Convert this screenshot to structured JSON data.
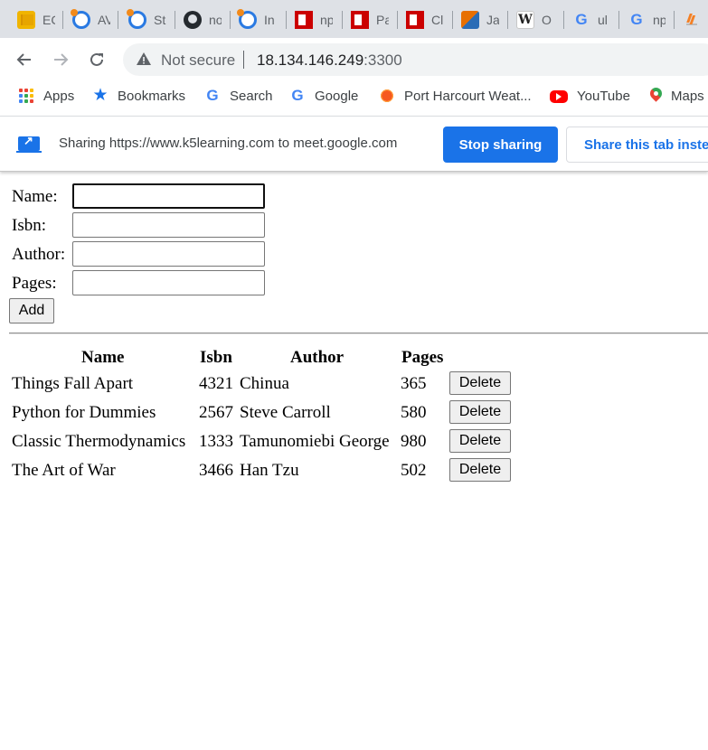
{
  "browser": {
    "tabs": [
      {
        "icon": "aws-box-icon",
        "title": "EC"
      },
      {
        "icon": "ubuntu-icon",
        "title": "AV"
      },
      {
        "icon": "ubuntu-icon",
        "title": "St"
      },
      {
        "icon": "github-icon",
        "title": "no"
      },
      {
        "icon": "ubuntu-icon",
        "title": "In"
      },
      {
        "icon": "npm-icon",
        "title": "np"
      },
      {
        "icon": "npm-icon",
        "title": "Pa"
      },
      {
        "icon": "npm-icon",
        "title": "Cl"
      },
      {
        "icon": "java-icon",
        "title": "Ja"
      },
      {
        "icon": "wikipedia-icon",
        "title": "O"
      },
      {
        "icon": "google-icon",
        "title": "ul"
      },
      {
        "icon": "google-icon",
        "title": "np"
      },
      {
        "icon": "stackoverflow-icon",
        "title": ""
      }
    ],
    "wiki_letter": "W",
    "google_letter": "G",
    "address": {
      "security_label": "Not secure",
      "host": "18.134.146.249",
      "port": ":3300"
    },
    "bookmarks": [
      {
        "icon": "apps-icon",
        "label": "Apps"
      },
      {
        "icon": "bookmarks-star-icon",
        "label": "Bookmarks"
      },
      {
        "icon": "google-icon",
        "label": "Search"
      },
      {
        "icon": "google-icon",
        "label": "Google"
      },
      {
        "icon": "weather-sun-icon",
        "label": "Port Harcourt Weat..."
      },
      {
        "icon": "youtube-icon",
        "label": "YouTube"
      },
      {
        "icon": "maps-pin-icon",
        "label": "Maps"
      }
    ],
    "sharing": {
      "message": "Sharing https://www.k5learning.com to meet.google.com",
      "stop_label": "Stop sharing",
      "share_tab_label": "Share this tab instead"
    },
    "colors": {
      "accent": "#1a73e8",
      "tabstrip": "#dee1e6"
    }
  },
  "form": {
    "name_label": "Name:",
    "isbn_label": "Isbn:",
    "author_label": "Author:",
    "pages_label": "Pages:",
    "name_value": "",
    "isbn_value": "",
    "author_value": "",
    "pages_value": "",
    "add_label": "Add"
  },
  "table": {
    "headers": {
      "name": "Name",
      "isbn": "Isbn",
      "author": "Author",
      "pages": "Pages"
    },
    "delete_label": "Delete",
    "rows": [
      {
        "name": "Things Fall Apart",
        "isbn": "4321",
        "author": "Chinua",
        "pages": "365"
      },
      {
        "name": "Python for Dummies",
        "isbn": "2567",
        "author": "Steve Carroll",
        "pages": "580"
      },
      {
        "name": "Classic Thermodynamics",
        "isbn": "1333",
        "author": "Tamunomiebi George",
        "pages": "980"
      },
      {
        "name": "The Art of War",
        "isbn": "3466",
        "author": "Han Tzu",
        "pages": "502"
      }
    ]
  }
}
